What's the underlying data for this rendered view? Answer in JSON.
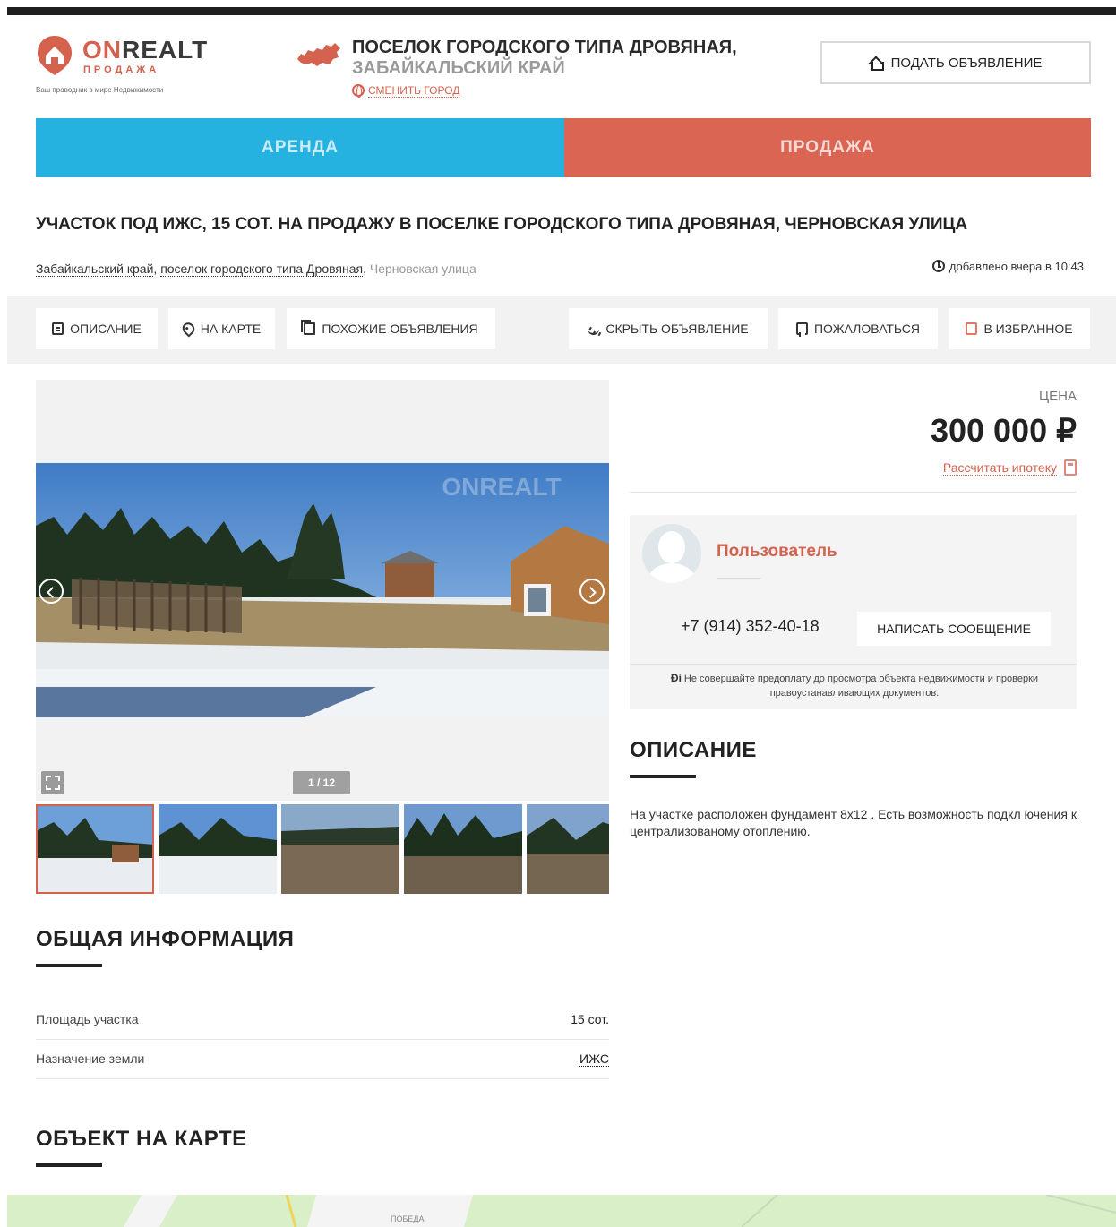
{
  "header": {
    "logo": {
      "name_accent": "ON",
      "name_rest": "REALT",
      "sub": "ПРОДАЖА",
      "tagline": "Ваш проводник в мире Недвижимости"
    },
    "region": {
      "line1": "ПОСЕЛОК ГОРОДСКОГО ТИПА ДРОВЯНАЯ,",
      "line2": "ЗАБАЙКАЛЬСКИЙ КРАЙ",
      "change_city": "СМЕНИТЬ ГОРОД"
    },
    "post_ad_label": "ПОДАТЬ ОБЪЯВЛЕНИЕ"
  },
  "tabs": {
    "rent": "АРЕНДА",
    "sale": "ПРОДАЖА"
  },
  "listing": {
    "title": "УЧАСТОК ПОД ИЖС, 15 СОТ. НА ПРОДАЖУ В ПОСЕЛКЕ ГОРОДСКОГО ТИПА ДРОВЯНАЯ, ЧЕРНОВСКАЯ УЛИЦА",
    "breadcrumb": {
      "region": "Забайкальский край",
      "city": "поселок городского типа Дровяная",
      "street": "Черновская улица"
    },
    "added": "добавлено вчера в 10:43"
  },
  "actions": {
    "description": "ОПИСАНИЕ",
    "on_map": "НА КАРТЕ",
    "similar": "ПОХОЖИЕ ОБЪЯВЛЕНИЯ",
    "hide": "СКРЫТЬ ОБЪЯВЛЕНИЕ",
    "report": "ПОЖАЛОВАТЬСЯ",
    "favorite": "В ИЗБРАННОЕ"
  },
  "gallery": {
    "counter": "1 / 12",
    "watermark": "ONREALT",
    "thumb_count": 5
  },
  "price": {
    "label": "ЦЕНА",
    "value": "300 000 ₽",
    "mortgage": "Рассчитать ипотеку"
  },
  "contact": {
    "name": "Пользователь",
    "phone": "+7 (914) 352-40-18",
    "message_button": "НАПИСАТЬ СООБЩЕНИЕ",
    "warning": "Не совершайте предоплату до просмотра объекта недвижимости и проверки правоустанавливающих документов."
  },
  "description": {
    "title": "ОПИСАНИЕ",
    "text": "На участке расположен фундамент 8х12 . Есть возможность подкл ючения к централизованому отоплению."
  },
  "general": {
    "title": "ОБЩАЯ ИНФОРМАЦИЯ",
    "rows": [
      {
        "key": "Площадь участка",
        "value": "15 сот."
      },
      {
        "key": "Назначение земли",
        "value": "ИЖС"
      }
    ]
  },
  "map_section": {
    "title": "ОБЪЕКТ НА КАРТЕ",
    "label": "ПОБЕДА"
  },
  "colors": {
    "accent": "#d5624f",
    "rent_tab": "#26b2e0",
    "sale_tab": "#da6553"
  }
}
